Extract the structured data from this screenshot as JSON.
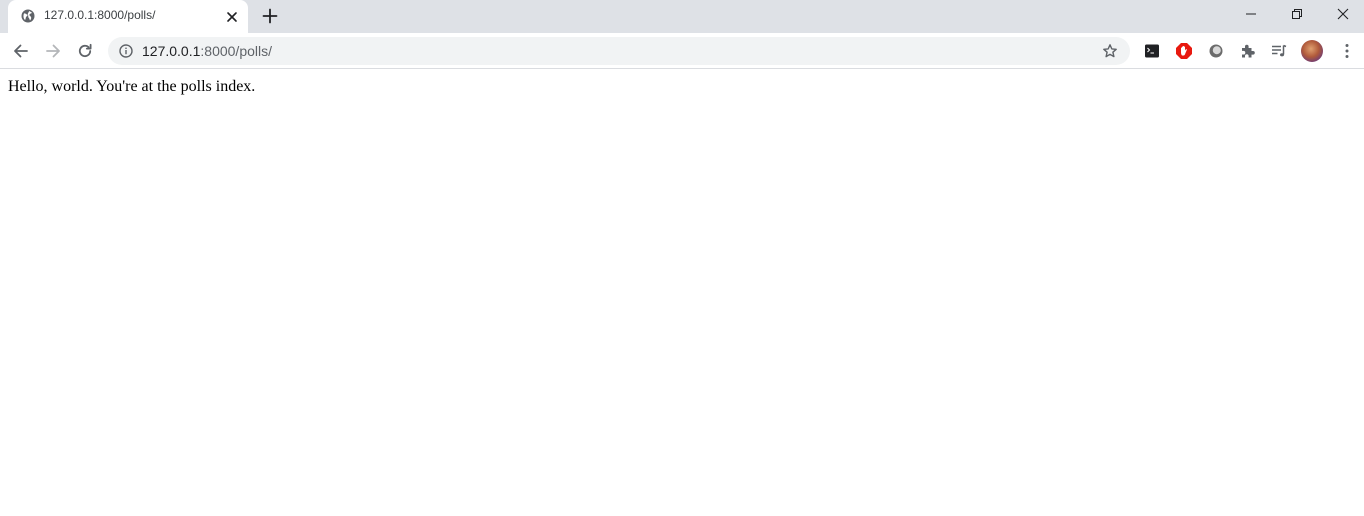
{
  "tab": {
    "title": "127.0.0.1:8000/polls/",
    "favicon": "globe-icon"
  },
  "omnibox": {
    "host": "127.0.0.1",
    "path": ":8000/polls/"
  },
  "page": {
    "body_text": "Hello, world. You're at the polls index."
  },
  "colors": {
    "tabstrip_bg": "#dee1e6",
    "omnibox_bg": "#f1f3f4",
    "extension_red": "#e8190f"
  },
  "icons": {
    "toolbar": [
      "back-arrow-icon",
      "forward-arrow-icon",
      "reload-icon",
      "info-icon",
      "star-icon"
    ],
    "extensions": [
      "terminal-extension-icon",
      "adblock-extension-icon",
      "circle-extension-icon",
      "puzzle-extension-icon",
      "media-queue-icon"
    ],
    "window": [
      "minimize-icon",
      "restore-icon",
      "close-icon"
    ]
  }
}
